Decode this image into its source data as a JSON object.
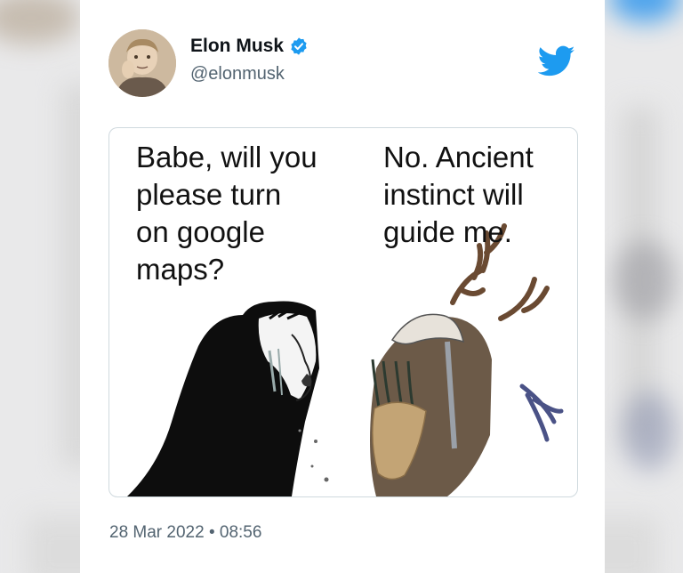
{
  "author": {
    "name": "Elon Musk",
    "handle": "@elonmusk",
    "verified": true
  },
  "meme": {
    "left_text": "Babe, will you\nplease turn\non google\nmaps?",
    "right_text": "No. Ancient\ninstinct will\nguide me."
  },
  "timestamp": "28 Mar 2022 • 08:56",
  "colors": {
    "twitter_blue": "#1d9bf0",
    "handle_gray": "#536471",
    "name_black": "#0f1419"
  },
  "icons": {
    "verified": "verified-badge-icon",
    "brand": "twitter-bird-icon"
  }
}
